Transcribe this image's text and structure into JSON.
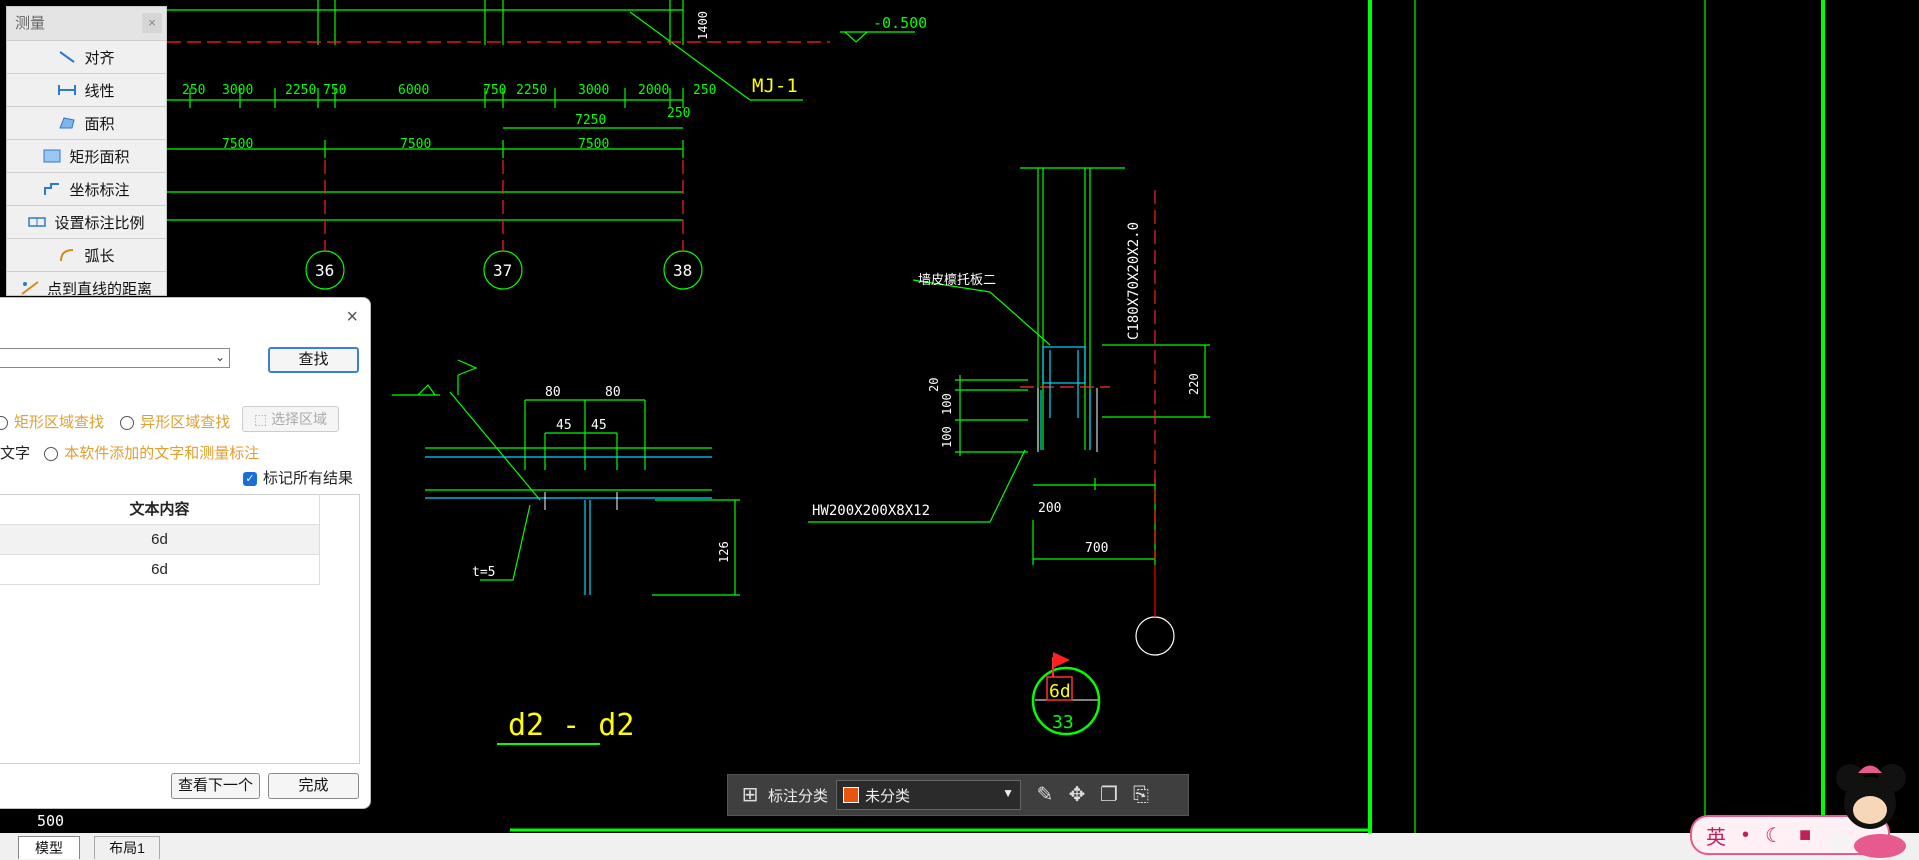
{
  "measure_panel": {
    "title": "测量",
    "close": "×",
    "items": [
      {
        "label": "对齐",
        "icon": "aligned-dimension-icon"
      },
      {
        "label": "线性",
        "icon": "linear-dimension-icon"
      },
      {
        "label": "面积",
        "icon": "area-icon"
      },
      {
        "label": "矩形面积",
        "icon": "rect-area-icon"
      },
      {
        "label": "坐标标注",
        "icon": "coordinate-icon"
      },
      {
        "label": "设置标注比例",
        "icon": "scale-icon"
      },
      {
        "label": "弧长",
        "icon": "arc-length-icon"
      },
      {
        "label": "点到直线的距离",
        "icon": "point-line-distance-icon"
      }
    ]
  },
  "find_dialog": {
    "close": "×",
    "find_button": "查找",
    "rect_region": "矩形区域查找",
    "shape_region": "异形区域查找",
    "select_region": "选择区域",
    "text_option": "文字",
    "software_text_option": "本软件添加的文字和测量标注",
    "mark_all": "标记所有结果",
    "table_header": "文本内容",
    "results": [
      "6d",
      "6d"
    ],
    "next_button": "查看下一个",
    "done_button": "完成"
  },
  "bottom_toolbar": {
    "category_label": "标注分类",
    "category_value": "未分类",
    "category_color": "#e8560e"
  },
  "statusbar": {
    "scale_value": "500",
    "tabs": [
      "模型",
      "布局1"
    ]
  },
  "ime": {
    "lang": "英"
  },
  "drawing": {
    "dims_row1": [
      "250",
      "3000",
      "2250",
      "750",
      "6000",
      "750",
      "2250",
      "3000",
      "2000",
      "250"
    ],
    "dims_row2": [
      "7500",
      "7500",
      "7500"
    ],
    "dim_7250": "7250",
    "dim_250b": "250",
    "dim_1400": "1400",
    "level": "-0.500",
    "mj_label": "MJ-1",
    "axes": [
      "36",
      "37",
      "38"
    ],
    "dim_80a": "80",
    "dim_80b": "80",
    "dim_45a": "45",
    "dim_45b": "45",
    "dim_126": "126",
    "t_label": "t=5",
    "section_title": "d2 - d2",
    "plate_label": "墙皮檩托板二",
    "c_label": "C180X70X20X2.0",
    "hw_label": "HW200X200X8X12",
    "dim_20": "20",
    "dim_100a": "100",
    "dim_100b": "100",
    "dim_220": "220",
    "dim_200": "200",
    "dim_700": "700",
    "marker_top": "6d",
    "marker_bottom": "33"
  }
}
